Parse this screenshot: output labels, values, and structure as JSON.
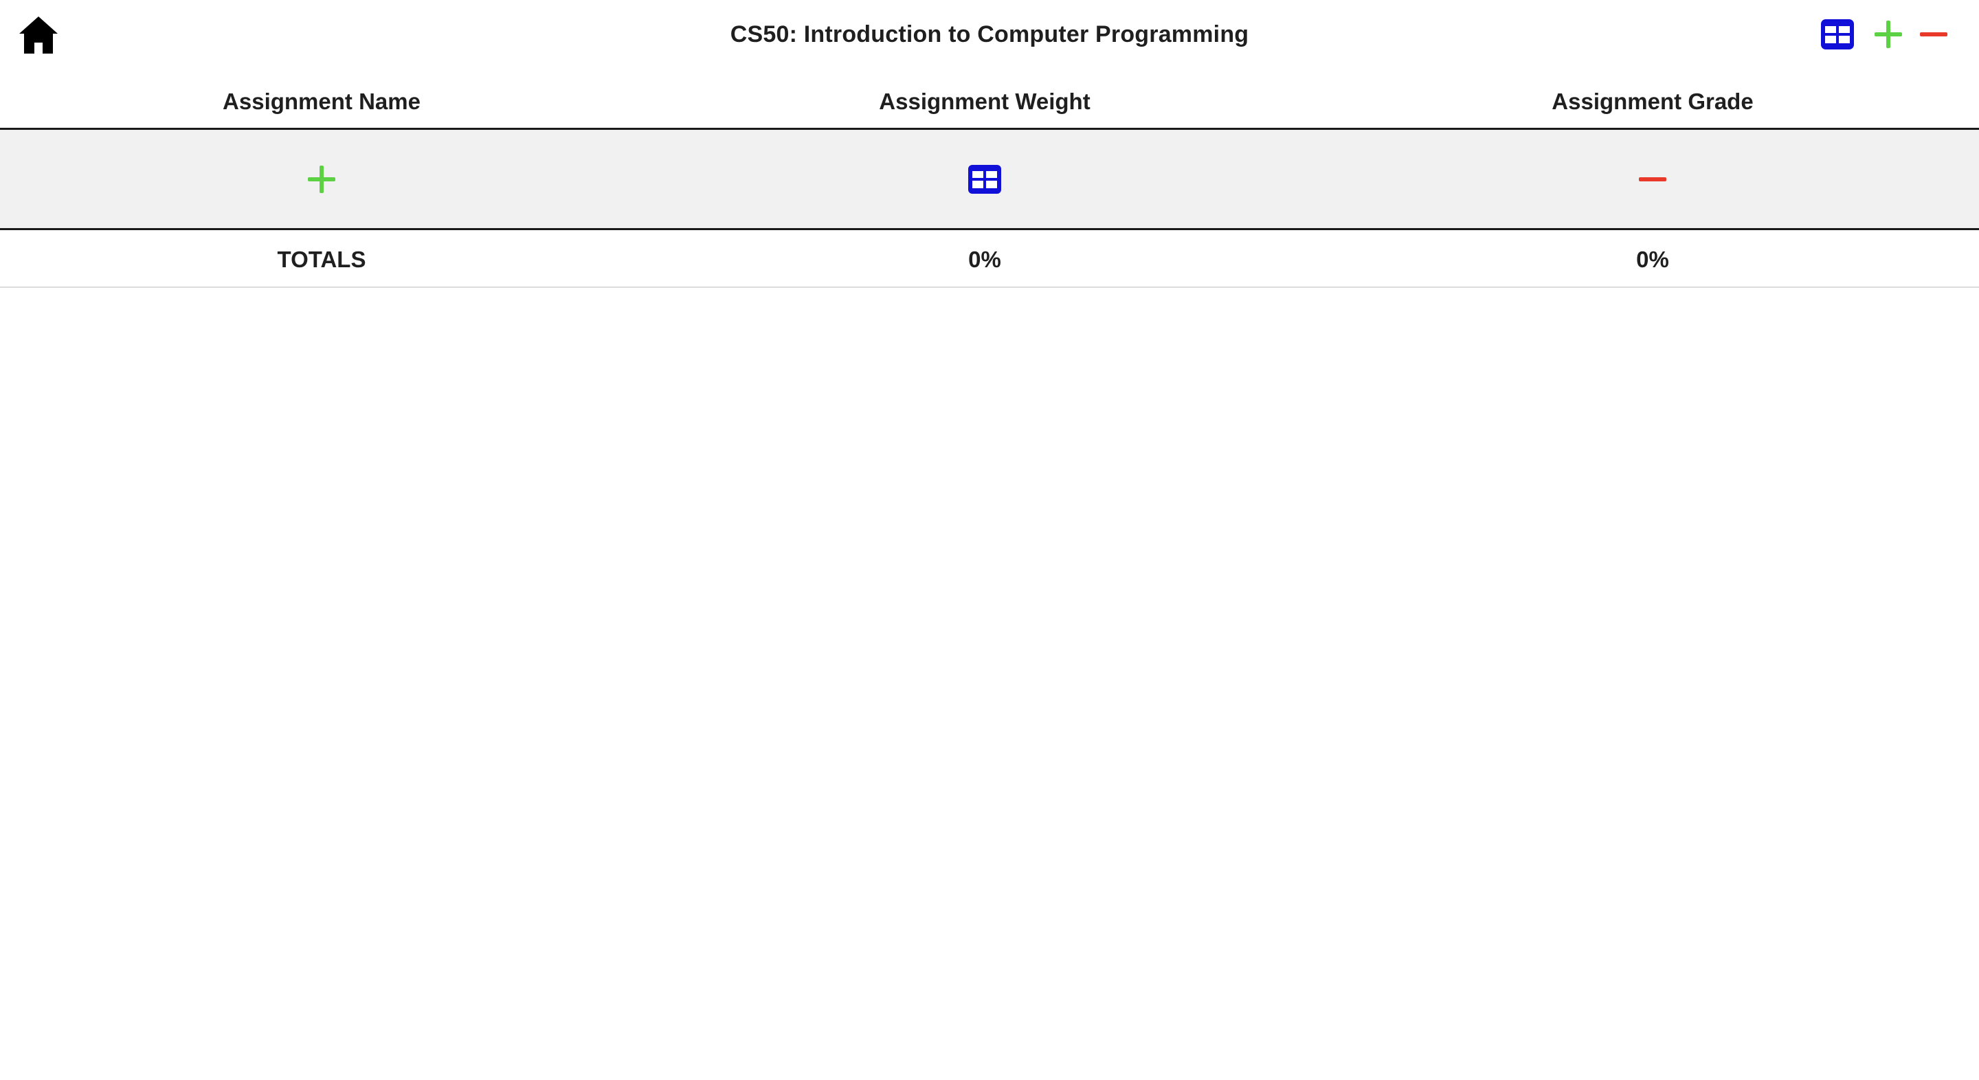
{
  "header": {
    "title": "CS50: Introduction to Computer Programming",
    "home_icon": "home-icon",
    "actions": [
      {
        "name": "table-icon",
        "color": "#1010d8"
      },
      {
        "name": "plus-icon",
        "color": "#5cd143"
      },
      {
        "name": "minus-icon",
        "color": "#e8392b"
      }
    ]
  },
  "table": {
    "columns": [
      "Assignment Name",
      "Assignment Weight",
      "Assignment Grade"
    ],
    "action_row": [
      {
        "icon": "plus-icon",
        "color": "#5cd143"
      },
      {
        "icon": "table-icon",
        "color": "#1010d8"
      },
      {
        "icon": "minus-icon",
        "color": "#e8392b"
      }
    ],
    "totals": {
      "label": "TOTALS",
      "weight": "0%",
      "grade": "0%"
    }
  },
  "colors": {
    "row_background": "#f1f1f1",
    "text": "#1f1f1f"
  }
}
